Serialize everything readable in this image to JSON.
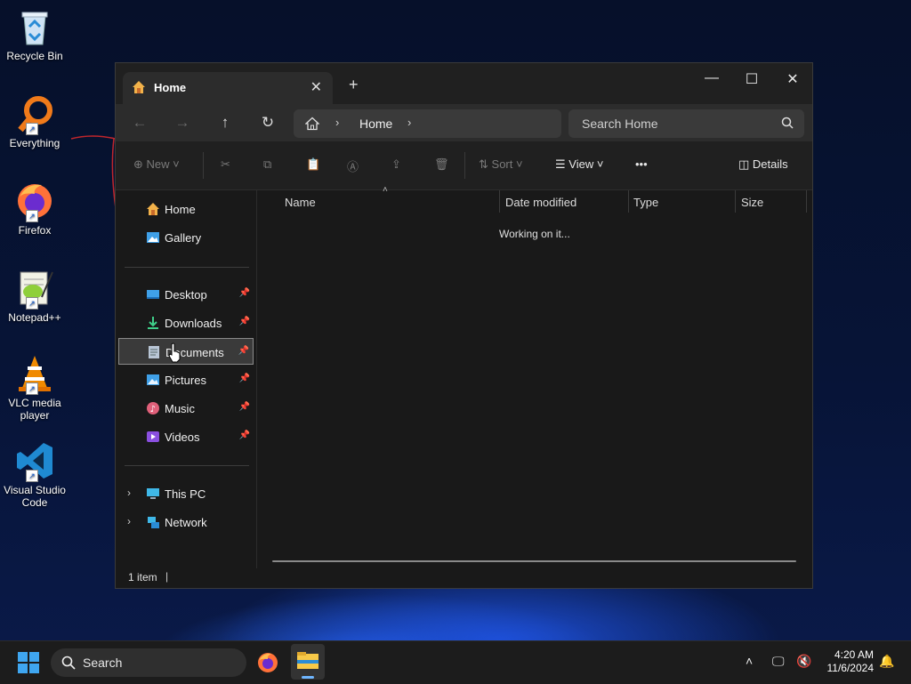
{
  "desktop": {
    "icons": [
      {
        "label": "Recycle Bin",
        "icon": "recycle-bin-icon"
      },
      {
        "label": "Everything",
        "icon": "everything-icon"
      },
      {
        "label": "Firefox",
        "icon": "firefox-icon"
      },
      {
        "label": "Notepad++",
        "icon": "notepadpp-icon"
      },
      {
        "label": "VLC media player",
        "icon": "vlc-icon"
      },
      {
        "label": "Visual Studio Code",
        "icon": "vscode-icon"
      }
    ]
  },
  "window": {
    "tab_title": "Home",
    "new_tab": "+",
    "address": {
      "crumb": "Home"
    },
    "search_placeholder": "Search Home",
    "toolbar": {
      "new_label": "New",
      "sort_label": "Sort",
      "view_label": "View",
      "more_label": "•••",
      "details_label": "Details"
    },
    "sidebar": {
      "top": [
        {
          "label": "Home",
          "icon": "home-icon"
        },
        {
          "label": "Gallery",
          "icon": "gallery-icon"
        }
      ],
      "pinned": [
        {
          "label": "Desktop",
          "icon": "desktop-folder-icon"
        },
        {
          "label": "Downloads",
          "icon": "downloads-icon"
        },
        {
          "label": "Documents",
          "icon": "documents-icon",
          "selected": true
        },
        {
          "label": "Pictures",
          "icon": "pictures-icon"
        },
        {
          "label": "Music",
          "icon": "music-icon"
        },
        {
          "label": "Videos",
          "icon": "videos-icon"
        }
      ],
      "bottom": [
        {
          "label": "This PC",
          "icon": "this-pc-icon"
        },
        {
          "label": "Network",
          "icon": "network-icon"
        }
      ]
    },
    "columns": [
      "Name",
      "Date modified",
      "Type",
      "Size"
    ],
    "status_message": "Working on it...",
    "status_count": "1 item"
  },
  "taskbar": {
    "search_label": "Search",
    "time": "4:20 AM",
    "date": "11/6/2024"
  },
  "colors": {
    "window_bg": "#191919",
    "accent": "#1a5fd0"
  }
}
